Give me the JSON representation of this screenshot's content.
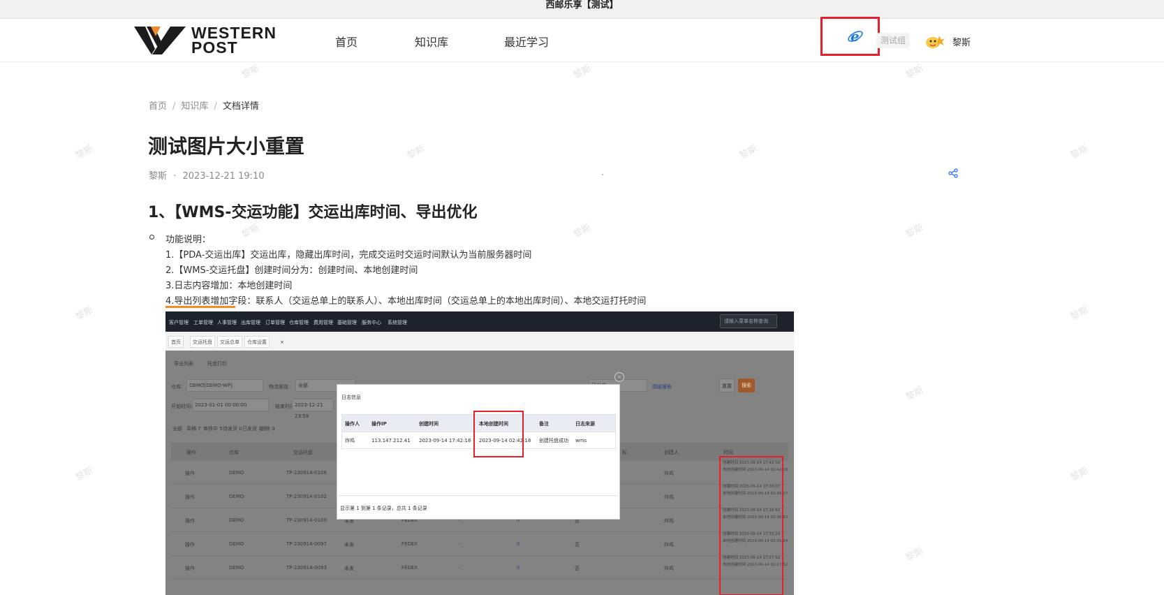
{
  "window": {
    "title": "西邮乐享【测试】"
  },
  "header": {
    "logo_text_line1": "WESTERN",
    "logo_text_line2": "POST",
    "nav": [
      "首页",
      "知识库",
      "最近学习"
    ],
    "group_badge": "测试组",
    "username": "黎斯"
  },
  "watermark": "黎斯",
  "breadcrumb": {
    "items": [
      "首页",
      "知识库",
      "文档详情"
    ],
    "separator": "/"
  },
  "doc": {
    "title": "测试图片大小重置",
    "author": "黎斯",
    "meta_dot": "·",
    "date": "2023-12-21 19:10"
  },
  "section": {
    "heading": "1、【WMS-交运功能】交运出库时间、导出优化",
    "bullet_label": "功能说明：",
    "lines": [
      "1.【PDA-交运出库】交运出库，隐藏出库时间，完成交运时交运时间默认为当前服务器时间",
      "2.【WMS-交运托盘】创建时间分为：创建时间、本地创建时间",
      "3.日志内容增加：本地创建时间",
      "4.导出列表增加字段：联系人（交运总单上的联系人）、本地出库时间（交运总单上的本地出库时间）、本地交运打托时间"
    ]
  },
  "screenshot": {
    "topnav": [
      "客户管理",
      "工单管理",
      "人事管理",
      "出库管理",
      "订单管理",
      "仓库管理",
      "费用管理",
      "基础管理",
      "服务中心",
      "系统管理"
    ],
    "search_placeholder": "请输入菜单名称查询",
    "tabs": [
      "首页",
      "交运托盘",
      "交运总单",
      "仓库设置"
    ],
    "tab_close_all": "×",
    "toolbar": [
      "导出列表",
      "托盘打印"
    ],
    "filters": {
      "warehouse_label": "仓库:",
      "warehouse_value": "DEMO[DEMO-WP]",
      "carrier_label": "物流渠道:",
      "carrier_value": "全部",
      "start_label": "开始时间:",
      "start_value": "2023-01-01 00:00:00",
      "end_label": "结束时间:",
      "end_value": "2023-12-21 23:59",
      "status_value": "已出库",
      "advanced": "高级搜索",
      "reset": "重置",
      "search": "搜索"
    },
    "status_tabs": [
      "全部",
      "草稿 7",
      "审核中 5",
      "待发货 0",
      "已发货 1",
      "删除 0"
    ],
    "table_headers": [
      "操作",
      "仓库",
      "交运托盘",
      "",
      "",
      "",
      "标",
      "创建人",
      "时间"
    ],
    "rows": [
      {
        "op": "操作",
        "wh": "DEMO",
        "no": "TP-230914-0106",
        "c4": "",
        "c5": "",
        "c6": "",
        "c7": "",
        "creator": "炸鸡",
        "t1": "创建时间 2023-09-14 17:42:18",
        "t2": "本地创建时间 2023-09-14 02:42:18"
      },
      {
        "op": "操作",
        "wh": "DEMO",
        "no": "TP-230914-0102",
        "c4": "",
        "c5": "",
        "c6": "",
        "c7": "",
        "creator": "炸鸡",
        "t1": "创建时间 2023-09-14 17:38:07",
        "t2": "本地创建时间 2023-09-14 02:38:07"
      },
      {
        "op": "操作",
        "wh": "DEMO",
        "no": "TP-230914-0100",
        "c4": "未发",
        "c5": "FEDEX",
        "c6": "-",
        "c7": "0",
        "creator": "炸鸡",
        "t1": "创建时间 2023-09-14 17:36:52",
        "t2": "本地创建时间 2023-09-14 02:36:52"
      },
      {
        "op": "操作",
        "wh": "DEMO",
        "no": "TP-230914-0097",
        "c4": "未发",
        "c5": "FEDEX",
        "c6": "-",
        "c7": "0",
        "creator": "炸鸡",
        "t1": "创建时间 2023-09-14 17:35:24",
        "t2": "本地创建时间 2023-09-14 02:35:24"
      },
      {
        "op": "操作",
        "wh": "DEMO",
        "no": "TP-230914-0093",
        "c4": "未发",
        "c5": "FEDEX",
        "c6": "-",
        "c7": "0",
        "creator": "炸鸡",
        "t1": "创建时间 2023-09-14 17:27:52",
        "t2": "本地创建时间 2023-09-14 02:27:52"
      }
    ],
    "row_extra_c8": "否",
    "modal": {
      "title": "日志信息",
      "headers": [
        "操作人",
        "操作IP",
        "创建时间",
        "本地创建时间",
        "备注",
        "日志来源"
      ],
      "row": [
        "炸鸡",
        "113.147.212.41",
        "2023-09-14 17:42:18",
        "2023-09-14 02:42:18",
        "创建托盘成功",
        "wms"
      ],
      "footer": "显示第 1 到第 1 条记录，总共 1 条记录",
      "close": "×"
    }
  },
  "colors": {
    "highlight_red": "#e6202b",
    "accent_orange": "#f08a2a",
    "share_blue": "#2f6df6",
    "ie_blue": "#1e7ae6"
  },
  "icons": [
    "ie-icon",
    "share-icon",
    "avatar",
    "logo"
  ]
}
